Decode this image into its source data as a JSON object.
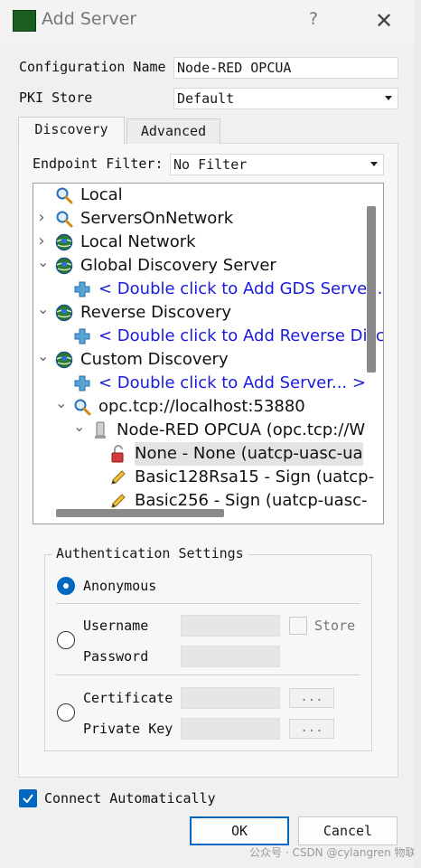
{
  "window": {
    "title": "Add Server",
    "help": "?",
    "close": "✕"
  },
  "config": {
    "name_label": "Configuration Name",
    "name_value": "Node-RED OPCUA",
    "pki_label": "PKI Store",
    "pki_value": "Default"
  },
  "tabs": [
    {
      "label": "Discovery",
      "active": true
    },
    {
      "label": "Advanced",
      "active": false
    }
  ],
  "endpoint_filter": {
    "label": "Endpoint Filter:",
    "value": "No Filter"
  },
  "tree": [
    {
      "text": "Local",
      "icon": "magnifier-icon",
      "expander": "",
      "link": false
    },
    {
      "text": "ServersOnNetwork",
      "icon": "magnifier-icon",
      "expander": "collapsed",
      "link": false
    },
    {
      "text": "Local Network",
      "icon": "network-globe-icon",
      "expander": "collapsed",
      "link": false
    },
    {
      "text": "Global Discovery Server",
      "icon": "network-globe-icon",
      "expander": "expanded",
      "link": false
    },
    {
      "text": "< Double click to Add GDS Server...",
      "icon": "plus-icon",
      "expander": "",
      "link": true
    },
    {
      "text": "Reverse Discovery",
      "icon": "network-globe-icon",
      "expander": "expanded",
      "link": false
    },
    {
      "text": "< Double click to Add Reverse Discovery...",
      "icon": "plus-icon",
      "expander": "",
      "link": true
    },
    {
      "text": "Custom Discovery",
      "icon": "network-globe-icon",
      "expander": "expanded",
      "link": false
    },
    {
      "text": "< Double click to Add Server... >",
      "icon": "plus-icon",
      "expander": "",
      "link": true
    },
    {
      "text": "opc.tcp://localhost:53880",
      "icon": "magnifier-icon",
      "expander": "expanded",
      "link": false
    },
    {
      "text": "Node-RED OPCUA (opc.tcp://W",
      "icon": "server-icon",
      "expander": "expanded",
      "link": false
    },
    {
      "text": "None - None (uatcp-uasc-ua",
      "icon": "unlocked-padlock-icon",
      "expander": "",
      "link": false,
      "selected": true
    },
    {
      "text": "Basic128Rsa15 - Sign (uatcp-",
      "icon": "pencil-icon",
      "expander": "",
      "link": false
    },
    {
      "text": "Basic256 - Sign (uatcp-uasc-",
      "icon": "pencil-icon",
      "expander": "",
      "link": false
    }
  ],
  "auth": {
    "title": "Authentication Settings",
    "anonymous": "Anonymous",
    "username": "Username",
    "password": "Password",
    "store": "Store",
    "certificate": "Certificate",
    "private_key": "Private Key",
    "browse": "..."
  },
  "connect_auto": "Connect Automatically",
  "buttons": {
    "ok": "OK",
    "cancel": "Cancel"
  },
  "watermark": "公众号 · CSDN @cylangren 物联网",
  "colors": {
    "accent": "#0067c0",
    "link": "#1a1ad8",
    "icon_green": "#1b5e20"
  }
}
